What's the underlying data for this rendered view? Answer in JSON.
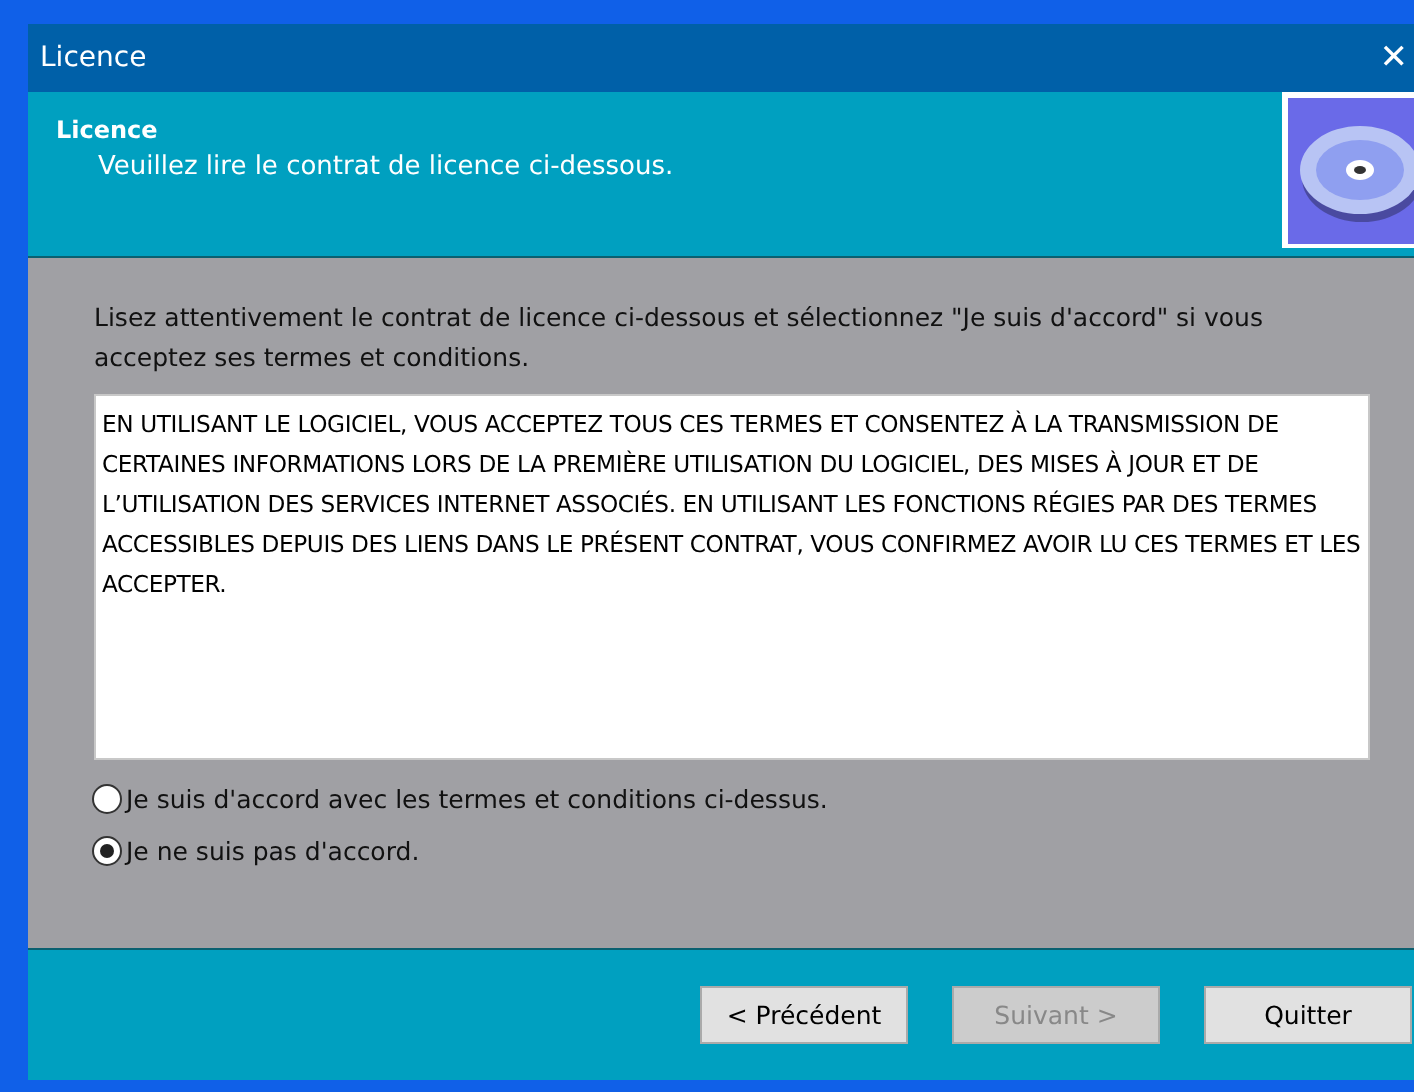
{
  "window": {
    "title": "Licence",
    "close": "✕"
  },
  "header": {
    "title": "Licence",
    "subtitle": "Veuillez lire le contrat de licence ci-dessous."
  },
  "instructions": "Lisez attentivement le contrat de licence ci-dessous et sélectionnez \"Je suis d'accord\" si vous acceptez ses termes et conditions.",
  "license_text": "EN UTILISANT LE LOGICIEL, VOUS ACCEPTEZ TOUS CES TERMES ET CONSENTEZ À LA TRANSMISSION DE CERTAINES INFORMATIONS LORS DE LA PREMIÈRE UTILISATION DU LOGICIEL, DES MISES À JOUR ET DE L’UTILISATION DES SERVICES INTERNET ASSOCIÉS. EN UTILISANT LES FONCTIONS RÉGIES PAR DES TERMES ACCESSIBLES DEPUIS DES LIENS DANS LE PRÉSENT CONTRAT, VOUS CONFIRMEZ AVOIR LU CES TERMES ET LES ACCEPTER.",
  "options": [
    {
      "label": "Je suis d'accord avec les termes et conditions ci-dessus.",
      "selected": false
    },
    {
      "label": "Je ne suis pas d'accord.",
      "selected": true
    }
  ],
  "buttons": [
    {
      "label": "< Précédent",
      "disabled": false
    },
    {
      "label": "Suivant >",
      "disabled": true
    },
    {
      "label": "Quitter",
      "disabled": false
    }
  ]
}
